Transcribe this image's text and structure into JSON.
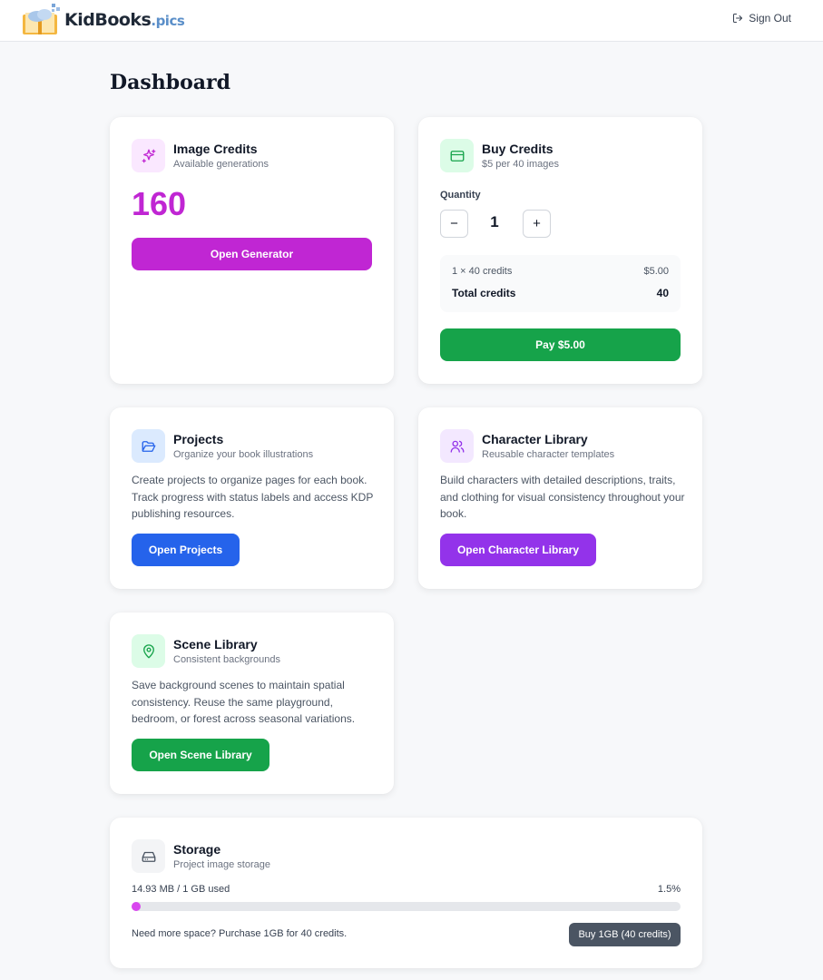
{
  "header": {
    "brand_main": "KidBooks",
    "brand_suffix": ".pics",
    "signout_label": "Sign Out"
  },
  "page_title": "Dashboard",
  "image_credits": {
    "title": "Image Credits",
    "subtitle": "Available generations",
    "value": "160",
    "button": "Open Generator",
    "icon": "sparkles-icon"
  },
  "buy_credits": {
    "title": "Buy Credits",
    "subtitle": "$5 per 40 images",
    "quantity_label": "Quantity",
    "quantity": "1",
    "minus": "−",
    "plus": "+",
    "line_label": "1 × 40 credits",
    "line_price": "$5.00",
    "total_label": "Total credits",
    "total_value": "40",
    "pay_button": "Pay $5.00",
    "icon": "credit-card-icon"
  },
  "projects": {
    "title": "Projects",
    "subtitle": "Organize your book illustrations",
    "description": "Create projects to organize pages for each book. Track progress with status labels and access KDP publishing resources.",
    "button": "Open Projects",
    "icon": "folder-open-icon"
  },
  "character_library": {
    "title": "Character Library",
    "subtitle": "Reusable character templates",
    "description": "Build characters with detailed descriptions, traits, and clothing for visual consistency throughout your book.",
    "button": "Open Character Library",
    "icon": "users-icon"
  },
  "scene_library": {
    "title": "Scene Library",
    "subtitle": "Consistent backgrounds",
    "description": "Save background scenes to maintain spatial consistency. Reuse the same playground, bedroom, or forest across seasonal variations.",
    "button": "Open Scene Library",
    "icon": "map-pin-icon"
  },
  "storage": {
    "title": "Storage",
    "subtitle": "Project image storage",
    "used_text": "14.93 MB / 1 GB used",
    "percent_text": "1.5%",
    "percent": 1.5,
    "note": "Need more space? Purchase 1GB for 40 credits.",
    "button": "Buy 1GB (40 credits)",
    "icon": "hard-drive-icon"
  },
  "colors": {
    "magenta": "#c026d3",
    "green": "#16a34a",
    "blue": "#2563eb",
    "purple": "#9333ea",
    "slate": "#4b5563"
  }
}
